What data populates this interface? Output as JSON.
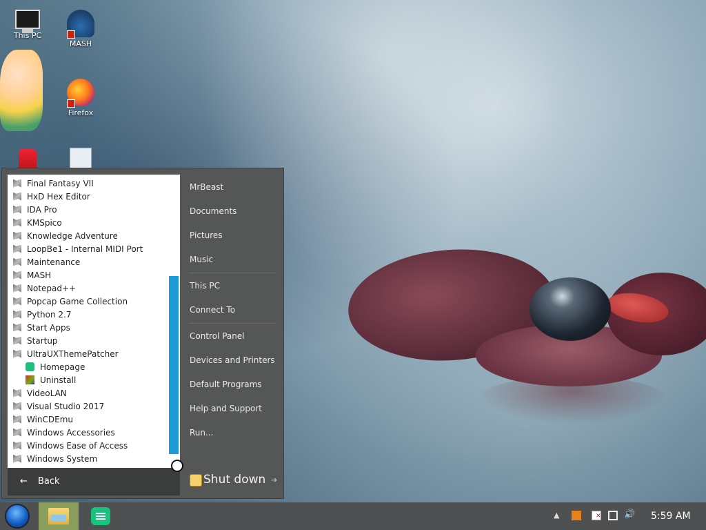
{
  "desktop": {
    "icons": [
      {
        "label": "This PC"
      },
      {
        "label": "MASH"
      },
      {
        "label": "Firefox"
      },
      {
        "label": ""
      },
      {
        "label": ""
      }
    ]
  },
  "start_menu": {
    "programs": [
      {
        "label": "Final Fantasy VII",
        "icon": "folder-icon"
      },
      {
        "label": "HxD Hex Editor",
        "icon": "folder-icon"
      },
      {
        "label": "IDA Pro",
        "icon": "folder-icon"
      },
      {
        "label": "KMSpico",
        "icon": "folder-icon"
      },
      {
        "label": "Knowledge Adventure",
        "icon": "folder-icon"
      },
      {
        "label": "LoopBe1 - Internal MIDI Port",
        "icon": "folder-icon"
      },
      {
        "label": "Maintenance",
        "icon": "folder-icon"
      },
      {
        "label": "MASH",
        "icon": "folder-icon"
      },
      {
        "label": "Notepad++",
        "icon": "folder-icon"
      },
      {
        "label": "Popcap Game Collection",
        "icon": "folder-icon"
      },
      {
        "label": "Python 2.7",
        "icon": "folder-icon"
      },
      {
        "label": "Start Apps",
        "icon": "folder-icon"
      },
      {
        "label": "Startup",
        "icon": "folder-icon"
      },
      {
        "label": "UltraUXThemePatcher",
        "icon": "folder-icon"
      },
      {
        "label": "Homepage",
        "icon": "homepage-icon"
      },
      {
        "label": "Uninstall",
        "icon": "uninstall-icon"
      },
      {
        "label": "VideoLAN",
        "icon": "folder-icon"
      },
      {
        "label": "Visual Studio 2017",
        "icon": "folder-icon"
      },
      {
        "label": "WinCDEmu",
        "icon": "folder-icon"
      },
      {
        "label": "Windows Accessories",
        "icon": "folder-icon"
      },
      {
        "label": "Windows Ease of Access",
        "icon": "folder-icon"
      },
      {
        "label": "Windows System",
        "icon": "folder-icon"
      }
    ],
    "back_label": "Back",
    "back_arrow": "←",
    "places": [
      {
        "label": "MrBeast"
      },
      {
        "label": "Documents"
      },
      {
        "label": "Pictures"
      },
      {
        "label": "Music"
      },
      {
        "label": "This PC"
      },
      {
        "label": "Connect To"
      },
      {
        "label": "Control Panel"
      },
      {
        "label": "Devices and Printers"
      },
      {
        "label": "Default Programs"
      },
      {
        "label": "Help and Support"
      },
      {
        "label": "Run..."
      }
    ],
    "shutdown_label": "Shut down",
    "shutdown_arrow": "➔"
  },
  "taskbar": {
    "tray_chevron": "▲",
    "volume_glyph": "🔊",
    "clock": "5:59 AM"
  },
  "colors": {
    "scrollbar_accent": "#1e9bd7",
    "menu_background": "#555656",
    "taskbar_background": "#4e5051"
  }
}
